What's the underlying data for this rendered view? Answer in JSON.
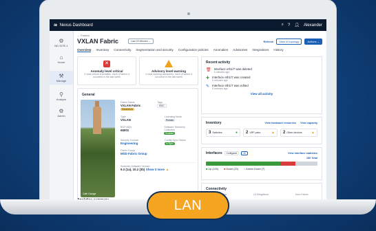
{
  "app": {
    "title": "Nexus Dashboard",
    "user": "Alexander"
  },
  "sidebar": {
    "site": "ND-SITE-1",
    "items": [
      {
        "label": "Home",
        "icon": "home-icon"
      },
      {
        "label": "Manage",
        "icon": "manage-icon"
      },
      {
        "label": "Analyze",
        "icon": "analyze-icon"
      },
      {
        "label": "Admin",
        "icon": "admin-icon"
      }
    ]
  },
  "header": {
    "breadcrumb": "← Fabrics",
    "title": "VXLAN Fabric",
    "time_range": "Last 15 Minutes ⌄",
    "refresh": "Refresh",
    "view_topology": "View in topology",
    "actions": "Actions ⌄"
  },
  "tabs": [
    "Overview",
    "Inventory",
    "Connectivity",
    "Segmentation and security",
    "Configuration policies",
    "Anomalies",
    "Advisories",
    "Integrations",
    "History"
  ],
  "anomaly": {
    "title": "Anomaly level critical",
    "desc": "X total critical anomalies, each of which it occurred in the last week"
  },
  "advisory": {
    "title": "Advisory level warning",
    "desc": "X total warning advisories, each of which it occurred in the last week"
  },
  "general": {
    "title": "General",
    "fabric_name_label": "Fabric Name",
    "fabric_name": "VXLAN Fabric",
    "fabric_badge": "Standalone",
    "tags_label": "Tags",
    "tags": "BSC",
    "type_label": "Type",
    "type": "VXLAN",
    "licensing_label": "Licensing Mode",
    "licensing": "Premier",
    "bgp_label": "BGP ASN",
    "bgp": "65001",
    "telemetry_label": "Software Telemetry Collection",
    "telemetry": "Enabled",
    "security_label": "Security Domain",
    "security": "Engineering",
    "config_label": "Config Sync Status",
    "config": "In Sync",
    "group_label": "Fabric Group",
    "group": "MSD Fabric Group",
    "software_label": "Switches Software Version",
    "software": "9.3 (1a), 10.2 (3b)",
    "software_more": "Show 3 more",
    "photo_caption": "Cafe Garage"
  },
  "recent": {
    "title": "Recent activity",
    "items": [
      {
        "text": "Interface eth1/7 was deleted",
        "time": "5 minutes ago",
        "icon": "trash-icon"
      },
      {
        "text": "Interface eth1/7 was created",
        "time": "5 minutes ago",
        "icon": "plus-icon"
      },
      {
        "text": "Interface eth1/7 was edited",
        "time": "5 minutes ago",
        "icon": "edit-icon"
      }
    ],
    "view_all": "View all activity"
  },
  "inventory": {
    "title": "Inventory",
    "link1": "View hardware resources",
    "link2": "View capacity",
    "chips": [
      {
        "count": "3",
        "label": "Switches",
        "status": "good"
      },
      {
        "count": "2",
        "label": "VRF pairs",
        "status": "warn"
      },
      {
        "count": "2",
        "label": "Other devices",
        "status": "warn"
      }
    ]
  },
  "interfaces": {
    "title": "Interfaces",
    "toggle_a": "Configured",
    "toggle_b": "All",
    "link": "View interface statistics",
    "total": "150 Total",
    "up": 100,
    "down": 20,
    "admin_down": 30,
    "legend_up": "Up (100)",
    "legend_down": "Down (20)",
    "legend_admin": "Admin Down (7)",
    "colors": {
      "up": "#3a9a3a",
      "down": "#d93a3a",
      "admin": "#cfd6de"
    }
  },
  "connectivity": {
    "title": "Connectivity",
    "endpoints_label": "Endpoints",
    "l3_label": "L3 Neighbors",
    "nonfabric_label": "Non-Fabric",
    "nonfabric": "3"
  },
  "analytics": {
    "title": "Analytics summary"
  },
  "banner": {
    "label": "LAN"
  }
}
